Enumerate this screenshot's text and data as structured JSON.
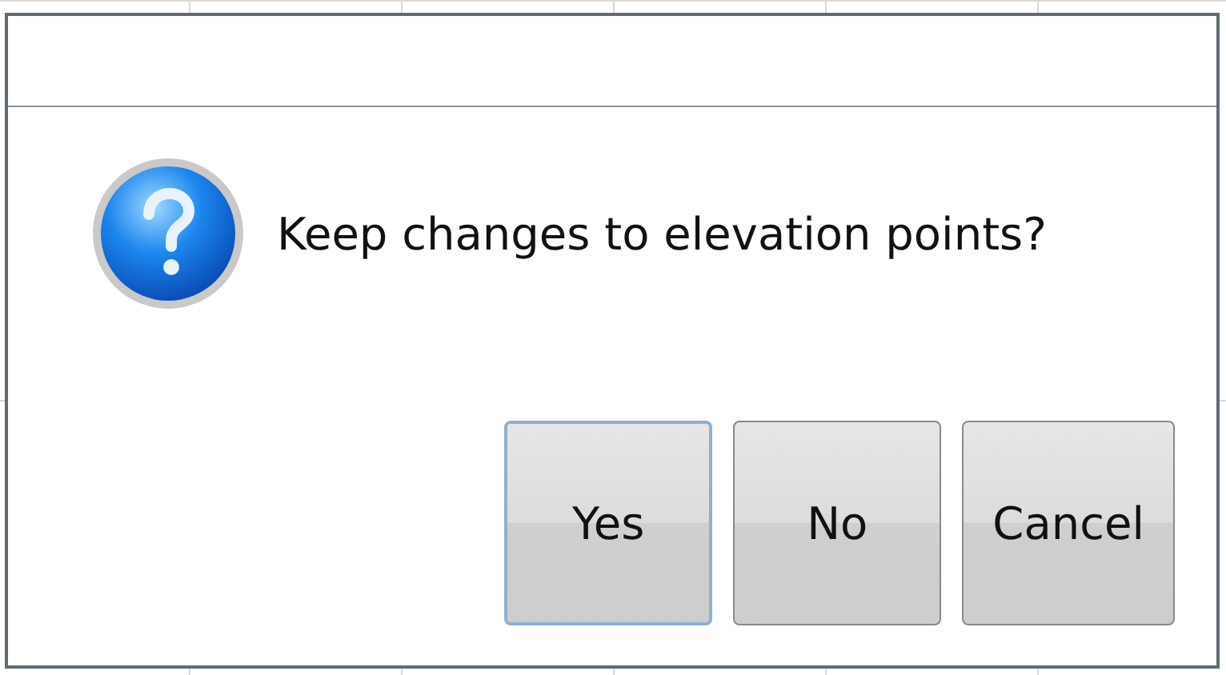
{
  "dialog": {
    "message": "Keep changes to elevation points?",
    "buttons": [
      {
        "label": "Yes",
        "focused": true
      },
      {
        "label": "No",
        "focused": false
      },
      {
        "label": "Cancel",
        "focused": false
      }
    ]
  }
}
